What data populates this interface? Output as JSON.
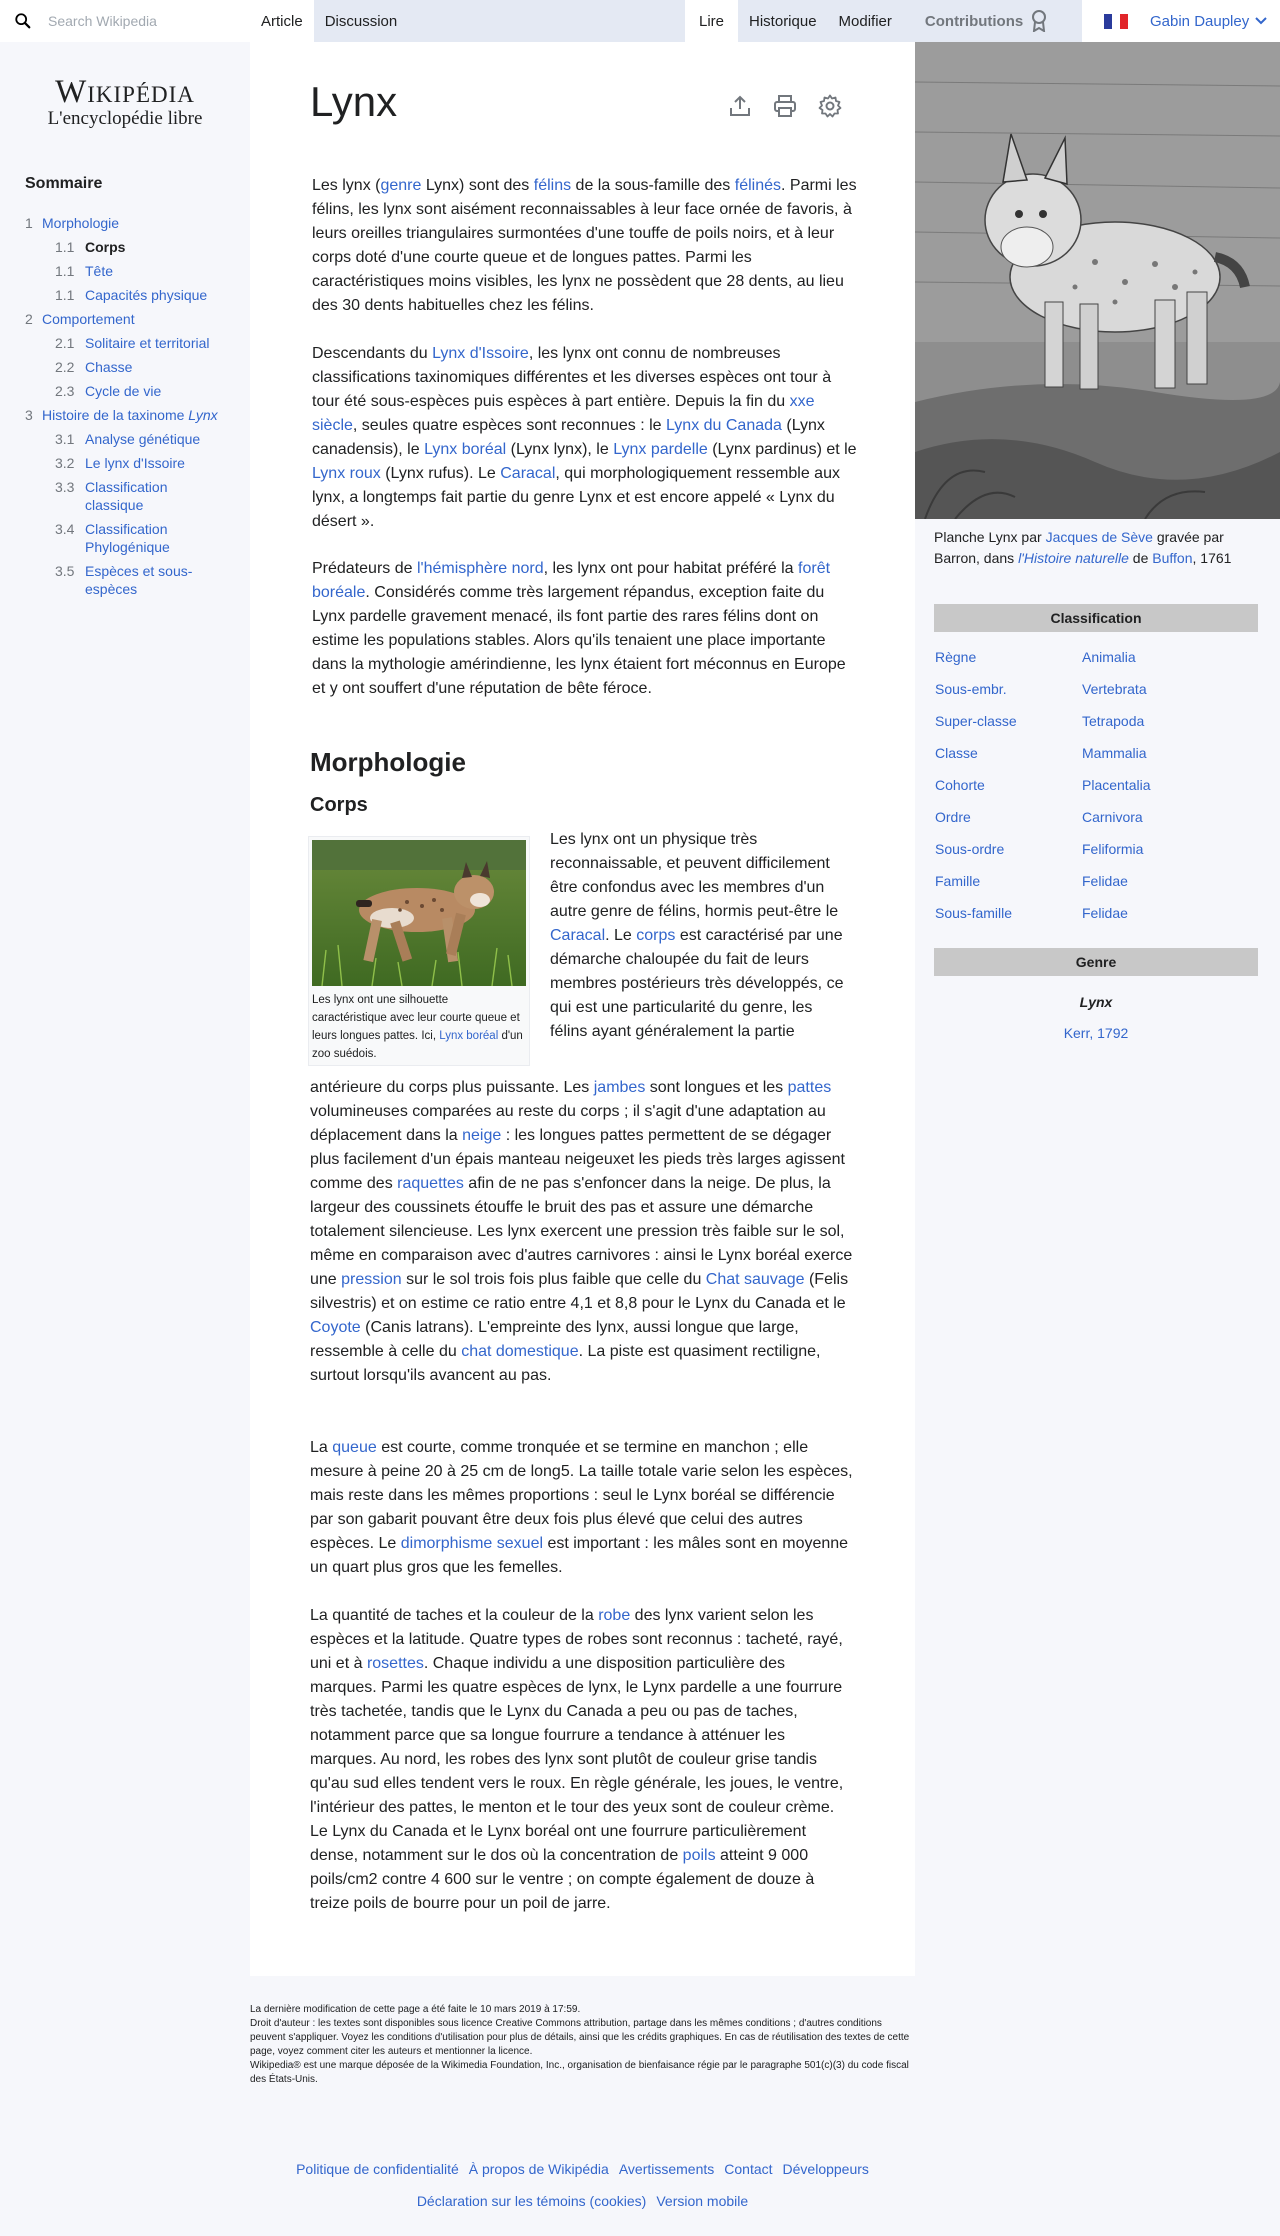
{
  "search": {
    "placeholder": "Search Wikipedia"
  },
  "tabs": {
    "article": "Article",
    "discussion": "Discussion",
    "read": "Lire",
    "history": "Historique",
    "edit": "Modifier",
    "contributions": "Contributions"
  },
  "user": {
    "name": "Gabin Daupley"
  },
  "logo": {
    "title": "Wikipédia",
    "subtitle": "L'encyclopédie libre"
  },
  "toc": {
    "title": "Sommaire",
    "items": [
      {
        "num": "1",
        "label": "Morphologie",
        "level": 1
      },
      {
        "num": "1.1",
        "label": "Corps",
        "level": 2,
        "current": true
      },
      {
        "num": "1.1",
        "label": "Tête",
        "level": 2
      },
      {
        "num": "1.1",
        "label": "Capacités physique",
        "level": 2
      },
      {
        "num": "2",
        "label": "Comportement",
        "level": 1
      },
      {
        "num": "2.1",
        "label": "Solitaire et territorial",
        "level": 2
      },
      {
        "num": "2.2",
        "label": "Chasse",
        "level": 2
      },
      {
        "num": "2.3",
        "label": "Cycle de vie",
        "level": 2
      },
      {
        "num": "3",
        "label": "Histoire de la taxinome",
        "label_em": "Lynx",
        "level": 1
      },
      {
        "num": "3.1",
        "label": "Analyse génétique",
        "level": 2
      },
      {
        "num": "3.2",
        "label": "Le lynx d'Issoire",
        "level": 2
      },
      {
        "num": "3.3",
        "label": "Classification classique",
        "level": 2
      },
      {
        "num": "3.4",
        "label": "Classification Phylogénique",
        "level": 2
      },
      {
        "num": "3.5",
        "label": "Espèces et sous-espèces",
        "level": 2
      }
    ]
  },
  "article": {
    "title": "Lynx",
    "paragraphs": {
      "p1": [
        {
          "t": "Les lynx ("
        },
        {
          "t": "genre",
          "l": 1
        },
        {
          "t": " Lynx) sont des "
        },
        {
          "t": "félins",
          "l": 1
        },
        {
          "t": " de la sous-famille des "
        },
        {
          "t": "félinés",
          "l": 1
        },
        {
          "t": ". Parmi les félins, les lynx sont aisément reconnaissables à leur face ornée de favoris, à leurs oreilles triangulaires surmontées d'une touffe de poils noirs, et à leur corps doté d'une courte queue et de longues pattes. Parmi les caractéristiques moins visibles, les lynx ne possèdent que 28 dents, au lieu des 30 dents habituelles chez les félins."
        }
      ],
      "p2": [
        {
          "t": "Descendants du "
        },
        {
          "t": "Lynx d'Issoire",
          "l": 1
        },
        {
          "t": ", les lynx ont connu de nombreuses classifications taxinomiques différentes et les diverses espèces ont tour à tour été sous-espèces puis espèces à part entière. Depuis la fin du "
        },
        {
          "t": "xxe siècle",
          "l": 1
        },
        {
          "t": ", seules quatre espèces sont reconnues : le "
        },
        {
          "t": "Lynx du Canada",
          "l": 1
        },
        {
          "t": " (Lynx canadensis), le "
        },
        {
          "t": "Lynx boréal",
          "l": 1
        },
        {
          "t": " (Lynx lynx), le "
        },
        {
          "t": "Lynx pardelle",
          "l": 1
        },
        {
          "t": " (Lynx pardinus) et le "
        },
        {
          "t": "Lynx roux",
          "l": 1
        },
        {
          "t": " (Lynx rufus). Le "
        },
        {
          "t": "Caracal",
          "l": 1
        },
        {
          "t": ", qui morphologiquement ressemble aux lynx, a longtemps fait partie du genre Lynx et est encore appelé « Lynx du désert »."
        }
      ],
      "p3": [
        {
          "t": "Prédateurs de "
        },
        {
          "t": "l'hémisphère nord",
          "l": 1
        },
        {
          "t": ", les lynx ont pour habitat préféré la "
        },
        {
          "t": "forêt boréale",
          "l": 1
        },
        {
          "t": ". Considérés comme très largement répandus, exception faite du Lynx pardelle gravement menacé, ils font partie des rares félins dont on estime les populations stables. Alors qu'ils tenaient une place importante dans la mythologie amérindienne, les lynx étaient fort méconnus en Europe et y ont souffert d'une réputation de bête féroce."
        }
      ],
      "corps_a": [
        {
          "t": "Les lynx ont un physique très reconnaissable, et peuvent difficilement être confondus avec les membres d'un autre genre de félins, hormis peut-être le "
        },
        {
          "t": "Caracal",
          "l": 1
        },
        {
          "t": ". Le "
        },
        {
          "t": "corps",
          "l": 1
        },
        {
          "t": " est caractérisé par une démarche chaloupée du fait de leurs membres postérieurs très développés, ce qui est une particularité du genre, les félins ayant généralement la partie"
        }
      ],
      "corps_b": [
        {
          "t": "antérieure du corps plus puissante. Les "
        },
        {
          "t": "jambes",
          "l": 1
        },
        {
          "t": " sont longues et les "
        },
        {
          "t": "pattes",
          "l": 1
        },
        {
          "t": " volumineuses comparées au reste du corps ; il s'agit d'une adaptation au déplacement dans la "
        },
        {
          "t": "neige",
          "l": 1
        },
        {
          "t": " : les longues pattes permettent de se dégager plus facilement d'un épais manteau neigeuxet les pieds très larges agissent comme des "
        },
        {
          "t": "raquettes",
          "l": 1
        },
        {
          "t": " afin de ne pas s'enfoncer dans la neige. De plus, la largeur des coussinets étouffe le bruit des pas et assure une démarche totalement silencieuse. Les lynx exercent une pression très faible sur le sol, même en comparaison avec d'autres carnivores : ainsi le Lynx boréal exerce une "
        },
        {
          "t": "pression",
          "l": 1
        },
        {
          "t": " sur le sol trois fois plus faible que celle du "
        },
        {
          "t": "Chat sauvage",
          "l": 1
        },
        {
          "t": " (Felis silvestris) et on estime ce ratio entre 4,1 et 8,8 pour le Lynx du Canada et le "
        },
        {
          "t": "Coyote",
          "l": 1
        },
        {
          "t": " (Canis latrans). L'empreinte des lynx, aussi longue que large, ressemble à celle du "
        },
        {
          "t": "chat domestique",
          "l": 1
        },
        {
          "t": ". La piste est quasiment rectiligne, surtout lorsqu'ils avancent au pas."
        }
      ],
      "queue": [
        {
          "t": "La "
        },
        {
          "t": "queue",
          "l": 1
        },
        {
          "t": " est courte, comme tronquée et se termine en manchon ; elle mesure à peine 20 à 25 cm de long5. La taille totale varie selon les espèces, mais reste dans les mêmes proportions : seul le Lynx boréal se différencie par son gabarit pouvant être deux fois plus élevé que celui des autres espèces. Le "
        },
        {
          "t": "dimorphisme sexuel",
          "l": 1
        },
        {
          "t": " est important : les mâles sont en moyenne un quart plus gros que les femelles."
        }
      ],
      "robe": [
        {
          "t": "La quantité de taches et la couleur de la "
        },
        {
          "t": "robe",
          "l": 1
        },
        {
          "t": " des lynx varient selon les espèces et la latitude. Quatre types de robes sont reconnus : tacheté, rayé, uni et à "
        },
        {
          "t": "rosettes",
          "l": 1
        },
        {
          "t": ". Chaque individu a une disposition particulière des marques. Parmi les quatre espèces de lynx, le Lynx pardelle a une fourrure très tachetée, tandis que le Lynx du Canada a peu ou pas de taches, notamment parce que sa longue fourrure a tendance à atténuer les marques. Au nord, les robes des lynx sont plutôt de couleur grise tandis qu'au sud elles tendent vers le roux. En règle générale, les joues, le ventre, l'intérieur des pattes, le menton et le tour des yeux sont de couleur crème. Le Lynx du Canada et le Lynx boréal ont une fourrure particulièrement dense, notamment sur le dos où la concentration de "
        },
        {
          "t": "poils",
          "l": 1
        },
        {
          "t": " atteint 9 000 poils/cm2 contre 4 600 sur le ventre ; on compte également de douze à treize poils de bourre pour un poil de jarre."
        }
      ]
    },
    "h2_morphologie": "Morphologie",
    "h3_corps": "Corps",
    "thumb_caption": [
      {
        "t": "Les lynx ont une silhouette caractéristique avec leur courte queue et leurs longues pattes. Ici, "
      },
      {
        "t": "Lynx boréal",
        "l": 1
      },
      {
        "t": " d'un zoo suédois."
      }
    ]
  },
  "infobox": {
    "caption": [
      {
        "t": "Planche Lynx par "
      },
      {
        "t": "Jacques de Sève",
        "l": 1
      },
      {
        "t": " gravée par Barron, dans "
      },
      {
        "t": "l'Histoire naturelle",
        "l": 1,
        "i": 1
      },
      {
        "t": " de "
      },
      {
        "t": "Buffon",
        "l": 1
      },
      {
        "t": ", 1761"
      }
    ],
    "classification_title": "Classification",
    "rows": [
      {
        "rank": "Règne",
        "taxon": "Animalia"
      },
      {
        "rank": "Sous-embr.",
        "taxon": "Vertebrata"
      },
      {
        "rank": "Super-classe",
        "taxon": "Tetrapoda"
      },
      {
        "rank": "Classe",
        "taxon": "Mammalia"
      },
      {
        "rank": "Cohorte",
        "taxon": "Placentalia"
      },
      {
        "rank": "Ordre",
        "taxon": "Carnivora"
      },
      {
        "rank": "Sous-ordre",
        "taxon": "Feliformia"
      },
      {
        "rank": "Famille",
        "taxon": "Felidae"
      },
      {
        "rank": "Sous-famille",
        "taxon": "Felidae"
      }
    ],
    "genre_title": "Genre",
    "genre_name": "Lynx",
    "genre_authority": "Kerr, 1792"
  },
  "footer": {
    "last_modified": "La dernière modification de cette page a été faite le 10 mars 2019 à 17:59.",
    "license": "Droit d'auteur : les textes sont disponibles sous licence Creative Commons attribution, partage dans les mêmes conditions ; d'autres conditions peuvent s'appliquer. Voyez les conditions d'utilisation pour plus de détails, ainsi que les crédits graphiques. En cas de réutilisation des textes de cette page, voyez comment citer les auteurs et mentionner la licence.",
    "trademark": "Wikipedia® est une marque déposée de la Wikimedia Foundation, Inc., organisation de bienfaisance régie par le paragraphe 501(c)(3) du code fiscal des États-Unis.",
    "links_row1": [
      "Politique de confidentialité",
      "À propos de Wikipédia",
      "Avertissements",
      "Contact",
      "Développeurs"
    ],
    "links_row2": [
      "Déclaration sur les témoins (cookies)",
      "Version mobile"
    ]
  },
  "colors": {
    "link": "#3366cc",
    "tabs_bg": "#e4e9f3",
    "page_bg": "#f6f7fb",
    "infobox_header": "#c8c8c8"
  }
}
